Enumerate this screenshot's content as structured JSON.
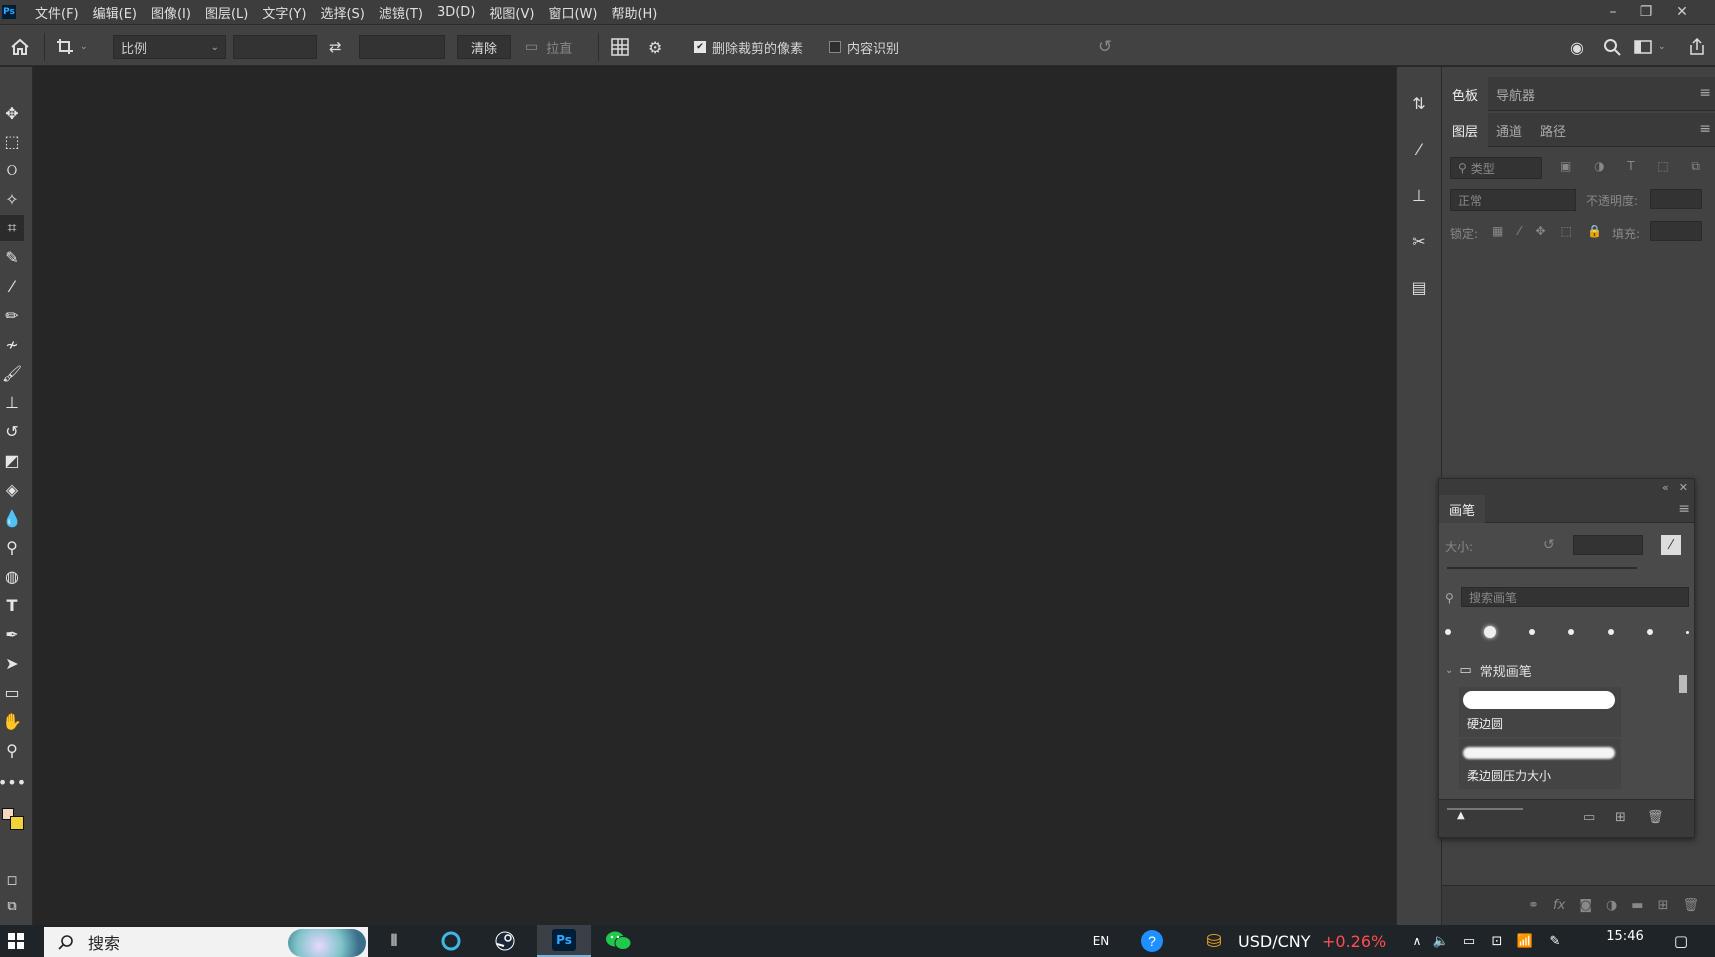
{
  "app": {
    "logo": "Ps"
  },
  "menu": {
    "items": [
      "文件(F)",
      "编辑(E)",
      "图像(I)",
      "图层(L)",
      "文字(Y)",
      "选择(S)",
      "滤镜(T)",
      "3D(D)",
      "视图(V)",
      "窗口(W)",
      "帮助(H)"
    ]
  },
  "window_controls": {
    "minimize": "–",
    "restore": "❐",
    "close": "✕"
  },
  "options": {
    "ratio_select": "比例",
    "clear_label": "清除",
    "straighten_label": "拉直",
    "delete_cropped_label": "删除裁剪的像素",
    "delete_cropped_checked": true,
    "content_aware_label": "内容识别",
    "content_aware_checked": false
  },
  "panels": {
    "top_tabs": [
      "色板",
      "导航器"
    ],
    "layer_tabs": [
      "图层",
      "通道",
      "路径"
    ],
    "filter_placeholder": "类型",
    "blend_mode": "正常",
    "opacity_label": "不透明度:",
    "lock_label": "锁定:",
    "fill_label": "填充:"
  },
  "brushes": {
    "title": "画笔",
    "size_label": "大小:",
    "search_placeholder": "搜索画笔",
    "group_name": "常规画笔",
    "items": [
      "硬边圆",
      "柔边圆压力大小"
    ]
  },
  "taskbar": {
    "search_placeholder": "搜索",
    "ime": "EN",
    "ticker_pair": "USD/CNY",
    "ticker_change": "+0.26%",
    "time": "15:46",
    "colors": {
      "ticker_change": "#ff4d4d",
      "ps_bg": "#001e36",
      "ps_text": "#31a8ff"
    }
  }
}
